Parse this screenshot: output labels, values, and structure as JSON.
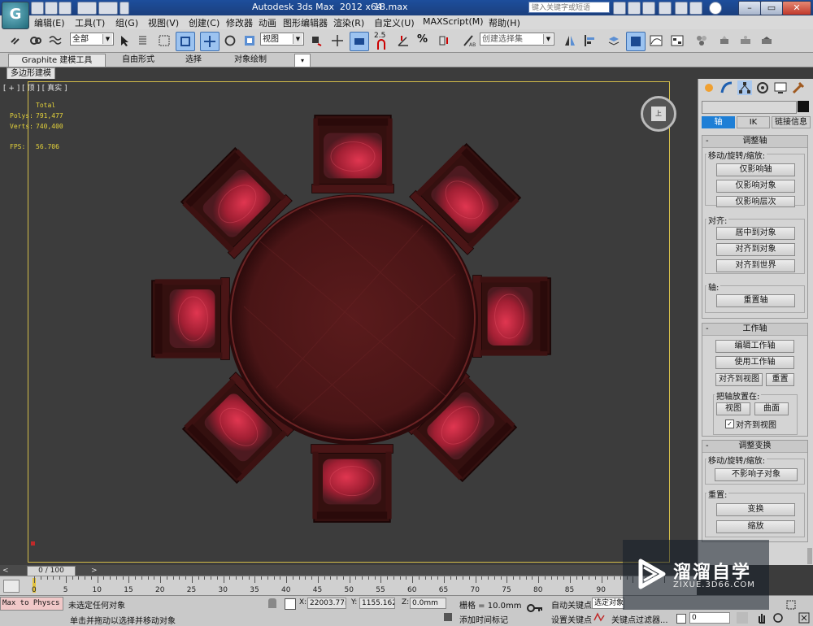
{
  "titlebar": {
    "app": "Autodesk 3ds Max  2012 x64",
    "file": "18.max",
    "search_placeholder": "键入关键字或短语"
  },
  "menu": [
    "编辑(E)",
    "工具(T)",
    "组(G)",
    "视图(V)",
    "创建(C)",
    "修改器",
    "动画",
    "图形编辑器",
    "渲染(R)",
    "自定义(U)",
    "MAXScript(M)",
    "帮助(H)"
  ],
  "toolbar": {
    "selection_filter": "全部",
    "reference_coord": "视图",
    "snap_value": "2.5",
    "named_selection": "创建选择集"
  },
  "ribbon": {
    "tabs": [
      "Graphite 建模工具",
      "自由形式",
      "选择",
      "对象绘制"
    ],
    "subtab": "多边形建模"
  },
  "viewport": {
    "label": "[ + ] [ 顶 ] [ 真实 ]",
    "viewcube_face": "上",
    "stats": {
      "total_label": "Total",
      "polys_label": "Polys:",
      "polys": "791,477",
      "verts_label": "Verts:",
      "verts": "740,400",
      "fps_label": "FPS:",
      "fps": "56.706"
    }
  },
  "command_panel": {
    "tabs": [
      "轴",
      "IK",
      "链接信息"
    ],
    "rollouts": {
      "adjust_pivot": {
        "title": "调整轴",
        "move_group": "移动/旋转/缩放:",
        "btn_pivot_only": "仅影响轴",
        "btn_object_only": "仅影响对象",
        "btn_hierarchy_only": "仅影响层次",
        "align_group": "对齐:",
        "btn_center": "居中到对象",
        "btn_align_object": "对齐到对象",
        "btn_align_world": "对齐到世界",
        "pivot_group": "轴:",
        "btn_reset": "重置轴"
      },
      "working_pivot": {
        "title": "工作轴",
        "btn_edit": "编辑工作轴",
        "btn_use": "使用工作轴",
        "btn_align_view": "对齐到视图",
        "btn_reset": "重置",
        "place_group": "把轴放置在:",
        "btn_view": "视图",
        "btn_surface": "曲面",
        "chk_align_view": "对齐到视图"
      },
      "adjust_transform": {
        "title": "调整变换",
        "move_group": "移动/旋转/缩放:",
        "btn_dont_affect": "不影响子对象",
        "reset_group": "重置:",
        "btn_transform": "变换",
        "btn_scale": "缩放"
      }
    }
  },
  "timeline": {
    "frame": "0 / 100",
    "ticks": [
      "0",
      "5",
      "10",
      "15",
      "20",
      "25",
      "30",
      "35",
      "40",
      "45",
      "50",
      "55",
      "60",
      "65",
      "70",
      "75",
      "80",
      "85",
      "90"
    ]
  },
  "status": {
    "maxscript": "Max to Physcs (",
    "selection": "未选定任何对象",
    "prompt": "单击并拖动以选择并移动对象",
    "x_label": "X:",
    "x_value": "22003.77m",
    "y_label": "Y:",
    "y_value": "1155.162m",
    "z_label": "Z:",
    "z_value": "0.0mm",
    "grid": "栅格 = 10.0mm",
    "add_time_tag": "添加时间标记",
    "auto_key": "自动关键点",
    "set_key": "设置关键点",
    "selected_object": "选定对象",
    "key_filters": "关键点过滤器...",
    "frame_value": "0"
  },
  "watermark": {
    "title": "溜溜自学",
    "url": "ZIXUE.3D66.COM"
  },
  "colors": {
    "title_blue": "#1b4a92",
    "viewport_bg": "#3c3c3c",
    "wood": "#5a1b1c",
    "cushion": "#b8253a",
    "stats_yellow": "#e4d23b",
    "active_tab": "#1e7fd6"
  }
}
